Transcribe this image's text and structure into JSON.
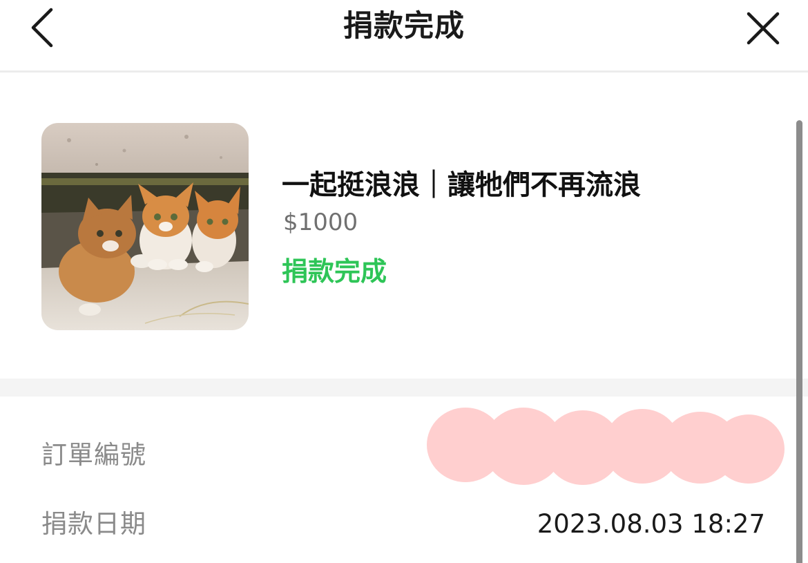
{
  "header": {
    "title": "捐款完成",
    "back_icon": "chevron-left-icon",
    "close_icon": "close-icon"
  },
  "donation": {
    "title": "一起挺浪浪｜讓牠們不再流浪",
    "amount": "$1000",
    "status": "捐款完成",
    "status_color": "#2ec557",
    "image": "kittens-photo"
  },
  "details": {
    "order_number_label": "訂單編號",
    "order_number_value": "",
    "order_number_redacted": true,
    "redaction_color": "#ffcfcf",
    "date_label": "捐款日期",
    "date_value": "2023.08.03 18:27"
  }
}
